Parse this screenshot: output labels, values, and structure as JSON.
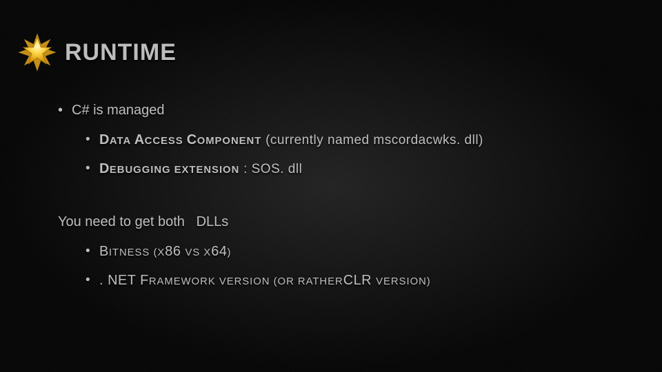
{
  "title": "RUNTIME",
  "bullets": {
    "l1": "C# is managed",
    "dac": {
      "label_cap1": "D",
      "label_rest1": "ATA ",
      "label_cap2": "A",
      "label_rest2": "CCESS ",
      "label_cap3": "C",
      "label_rest3": "OMPONENT",
      "suffix": " (currently named mscordacwks. dll)"
    },
    "dbg": {
      "label_cap1": "D",
      "label_rest1": "EBUGGING EXTENSION",
      "suffix": ": SOS. dll"
    },
    "need_prefix": "You need to get both",
    "need_suffix": "DLLs",
    "bitness": {
      "cap1": "B",
      "rest1": "ITNESS ",
      "open": "(",
      "x_a": "X",
      "num_a": "86 ",
      "vs": "VS ",
      "x_b": "X",
      "num_b": "64",
      "close": ")"
    },
    "fx": {
      "dot": ". ",
      "cap1": "NET F",
      "rest1": "RAMEWORK VERSION ",
      "open": "(",
      "or": "OR RATHER",
      "clr": "CLR ",
      "ver": "VERSION",
      "close": ")"
    }
  }
}
